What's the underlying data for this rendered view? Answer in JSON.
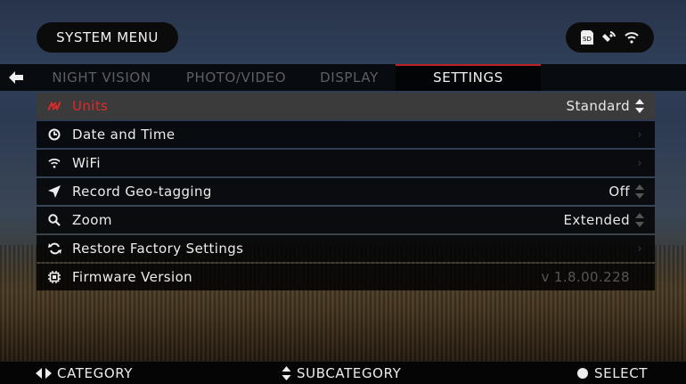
{
  "header": {
    "title": "SYSTEM MENU",
    "status_icons": [
      "sd-card-icon",
      "gps-satellite-icon",
      "wifi-icon"
    ]
  },
  "tabs": [
    {
      "label": "NIGHT VISION",
      "active": false
    },
    {
      "label": "PHOTO/VIDEO",
      "active": false
    },
    {
      "label": "DISPLAY",
      "active": false
    },
    {
      "label": "SETTINGS",
      "active": true
    }
  ],
  "settings": [
    {
      "icon": "ruler-arrows-icon",
      "label": "Units",
      "value": "Standard",
      "control": "updown",
      "selected": true
    },
    {
      "icon": "clock-icon",
      "label": "Date and Time",
      "value": "",
      "control": "chevron"
    },
    {
      "icon": "wifi-icon",
      "label": "WiFi",
      "value": "",
      "control": "chevron"
    },
    {
      "icon": "location-arrow-icon",
      "label": "Record Geo-tagging",
      "value": "Off",
      "control": "updown"
    },
    {
      "icon": "search-icon",
      "label": "Zoom",
      "value": "Extended",
      "control": "updown"
    },
    {
      "icon": "refresh-icon",
      "label": "Restore Factory Settings",
      "value": "",
      "control": "chevron"
    },
    {
      "icon": "chip-icon",
      "label": "Firmware Version",
      "value": "v 1.8.00.228",
      "control": "none"
    }
  ],
  "footer": {
    "category": "CATEGORY",
    "subcategory": "SUBCATEGORY",
    "select": "SELECT"
  },
  "colors": {
    "accent": "#e02a2a",
    "panel": "#000000",
    "selected_row": "#3b3b3b"
  }
}
